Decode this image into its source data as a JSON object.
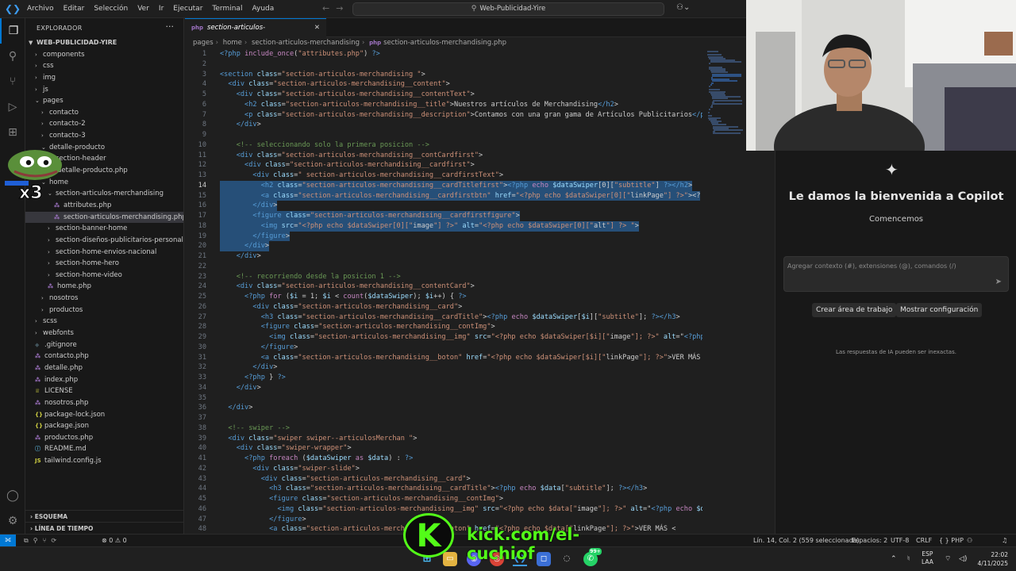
{
  "titlebar": {
    "menu": [
      "Archivo",
      "Editar",
      "Selección",
      "Ver",
      "Ir",
      "Ejecutar",
      "Terminal",
      "Ayuda"
    ],
    "search": "Web-Publicidad-Yire"
  },
  "sidebar": {
    "title": "EXPLORADOR",
    "root": "WEB-PUBLICIDAD-YIRE",
    "tree": [
      {
        "label": "components",
        "depth": 1,
        "kind": "folder",
        "open": false
      },
      {
        "label": "css",
        "depth": 1,
        "kind": "folder",
        "open": false
      },
      {
        "label": "img",
        "depth": 1,
        "kind": "folder",
        "open": false
      },
      {
        "label": "js",
        "depth": 1,
        "kind": "folder",
        "open": false
      },
      {
        "label": "pages",
        "depth": 1,
        "kind": "folder",
        "open": true
      },
      {
        "label": "contacto",
        "depth": 2,
        "kind": "folder",
        "open": false
      },
      {
        "label": "contacto-2",
        "depth": 2,
        "kind": "folder",
        "open": false
      },
      {
        "label": "contacto-3",
        "depth": 2,
        "kind": "folder",
        "open": false
      },
      {
        "label": "detalle-producto",
        "depth": 2,
        "kind": "folder",
        "open": true
      },
      {
        "label": "section-header",
        "depth": 3,
        "kind": "folder",
        "open": false
      },
      {
        "label": "detalle-producto.php",
        "depth": 3,
        "kind": "php"
      },
      {
        "label": "home",
        "depth": 2,
        "kind": "folder",
        "open": true
      },
      {
        "label": "section-articulos-merchandising",
        "depth": 3,
        "kind": "folder",
        "open": true
      },
      {
        "label": "attributes.php",
        "depth": 4,
        "kind": "php"
      },
      {
        "label": "section-articulos-merchandising.php",
        "depth": 4,
        "kind": "php",
        "selected": true
      },
      {
        "label": "section-banner-home",
        "depth": 3,
        "kind": "folder",
        "open": false
      },
      {
        "label": "section-diseños-publicitarios-personaliza...",
        "depth": 3,
        "kind": "folder",
        "open": false
      },
      {
        "label": "section-home-envios-nacional",
        "depth": 3,
        "kind": "folder",
        "open": false
      },
      {
        "label": "section-home-hero",
        "depth": 3,
        "kind": "folder",
        "open": false
      },
      {
        "label": "section-home-video",
        "depth": 3,
        "kind": "folder",
        "open": false
      },
      {
        "label": "home.php",
        "depth": 3,
        "kind": "php"
      },
      {
        "label": "nosotros",
        "depth": 2,
        "kind": "folder",
        "open": false
      },
      {
        "label": "productos",
        "depth": 2,
        "kind": "folder",
        "open": false
      },
      {
        "label": "scss",
        "depth": 1,
        "kind": "folder",
        "open": false
      },
      {
        "label": "webfonts",
        "depth": 1,
        "kind": "folder",
        "open": false
      },
      {
        "label": ".gitignore",
        "depth": 1,
        "kind": "git"
      },
      {
        "label": "contacto.php",
        "depth": 1,
        "kind": "php"
      },
      {
        "label": "detalle.php",
        "depth": 1,
        "kind": "php"
      },
      {
        "label": "index.php",
        "depth": 1,
        "kind": "php"
      },
      {
        "label": "LICENSE",
        "depth": 1,
        "kind": "license"
      },
      {
        "label": "nosotros.php",
        "depth": 1,
        "kind": "php"
      },
      {
        "label": "package-lock.json",
        "depth": 1,
        "kind": "json"
      },
      {
        "label": "package.json",
        "depth": 1,
        "kind": "json"
      },
      {
        "label": "productos.php",
        "depth": 1,
        "kind": "php"
      },
      {
        "label": "README.md",
        "depth": 1,
        "kind": "md"
      },
      {
        "label": "tailwind.config.js",
        "depth": 1,
        "kind": "js"
      }
    ],
    "sections": [
      "ESQUEMA",
      "LÍNEA DE TIEMPO"
    ]
  },
  "sticker_text": "x3",
  "editor": {
    "tab": "section-articulos-merchandising.php",
    "breadcrumb": [
      "pages",
      "home",
      "section-articulos-merchandising",
      "section-articulos-merchandising.php"
    ],
    "lines": [
      "<?php include_once(\"attributes.php\") ?>",
      "",
      "<section class=\"section-articulos-merchandising \">",
      "  <div class=\"section-articulos-merchandising__content\">",
      "    <div class=\"section-articulos-merchandising__contentText\">",
      "      <h2 class=\"section-articulos-merchandising__title\">Nuestros artículos de Merchandising</h2>",
      "      <p class=\"section-articulos-merchandising__description\">Contamos con una gran gama de Artículos Publicitarios</p",
      "    </div>",
      "",
      "    <!-- seleccionando solo la primera posicion -->",
      "    <div class=\"section-articulos-merchandising__contCardfirst\">",
      "      <div class=\"section-articulos-merchandising__cardfirst\">",
      "        <div class=\" section-articulos-merchandising__cardfirstText\">",
      "          <h2 class=\"section-articulos-merchandising__cardTitlefirst\"><?php echo $dataSwiper[0][\"subtitle\"] ?></h2>",
      "          <a class=\"section-articulos-merchandising__cardfirstbtn\" href=\"<?php echo $dataSwiper[0][\"linkPage\"] ?>\"><?",
      "        </div>",
      "        <figure class=\"section-articulos-merchandising__cardfirstfigure\">",
      "          <img src=\"<?php echo $dataSwiper[0][\"image\"] ?>\" alt=\"<?php echo $dataSwiper[0][\"alt\"] ?> \">",
      "        </figure>",
      "      </div>",
      "    </div>",
      "",
      "    <!-- recorriendo desde la posicion 1 -->",
      "    <div class=\"section-articulos-merchandising__contentCard\">",
      "      <?php for ($i = 1; $i < count($dataSwiper); $i++) { ?>",
      "        <div class=\"section-articulos-merchandising__card\">",
      "          <h3 class=\"section-articulos-merchandising__cardTitle\"><?php echo $dataSwiper[$i][\"subtitle\"]; ?></h3>",
      "          <figure class=\"section-articulos-merchandising__contImg\">",
      "            <img class=\"section-articulos-merchandising__img\" src=\"<?php echo $dataSwiper[$i][\"image\"]; ?>\" alt=\"<?php",
      "          </figure>",
      "          <a class=\"section-articulos-merchandising__boton\" href=\"<?php echo $dataSwiper[$i][\"linkPage\"]; ?>\">VER MÁS <",
      "        </div>",
      "      <?php } ?>",
      "    </div>",
      "",
      "  </div>",
      "",
      "  <!-- swiper -->",
      "  <div class=\"swiper swiper--articulosMerchan \">",
      "    <div class=\"swiper-wrapper\">",
      "      <?php foreach ($dataSwiper as $data) : ?>",
      "        <div class=\"swiper-slide\">",
      "          <div class=\"section-articulos-merchandising__card\">",
      "            <h3 class=\"section-articulos-merchandising__cardTitle\"><?php echo $data[\"subtitle\"]; ?></h3>",
      "            <figure class=\"section-articulos-merchandising__contImg\">",
      "              <img class=\"section-articulos-merchandising__img\" src=\"<?php echo $data[\"image\"]; ?>\" alt=\"<?php echo $da",
      "            </figure>",
      "            <a class=\"section-articulos-merchandising__boton\" href=\"<?php echo $data[\"linkPage\"]; ?>\">VER MÁS <"
    ],
    "highlight_lines": [
      14,
      15,
      16,
      17,
      18,
      19,
      20
    ],
    "cursor_line": 14
  },
  "copilot": {
    "welcome": "Le damos la bienvenida a Copilot",
    "subtitle": "Comencemos",
    "input_placeholder": "Agregar contexto (#), extensiones (@), comandos (/)",
    "btn_workspace": "Crear área de trabajo",
    "btn_settings": "Mostrar configuración",
    "disclaimer": "Las respuestas de IA pueden ser inexactas."
  },
  "statusbar": {
    "errors": "⊗ 0 ⚠ 0",
    "position": "Lín. 14, Col. 2 (559 seleccionada)",
    "spaces": "Espacios: 2",
    "encoding": "UTF-8",
    "eol": "CRLF",
    "language": "PHP"
  },
  "overlay": {
    "kick_letter": "K",
    "kick_url": "kick.com/el-cuchiof"
  },
  "taskbar": {
    "badge": "99+",
    "lang_top": "ESP",
    "lang_bottom": "LAA",
    "time": "22:02",
    "date": "4/11/2025"
  },
  "colors": {
    "accent": "#0078d4",
    "selection": "#264f78",
    "kick_green": "#53fc18",
    "tag": "#569cd6",
    "attr": "#9cdcfe",
    "string": "#ce9178",
    "comment": "#6a9955",
    "php_var": "#9cdcfe",
    "php_keyword": "#c586c0"
  }
}
